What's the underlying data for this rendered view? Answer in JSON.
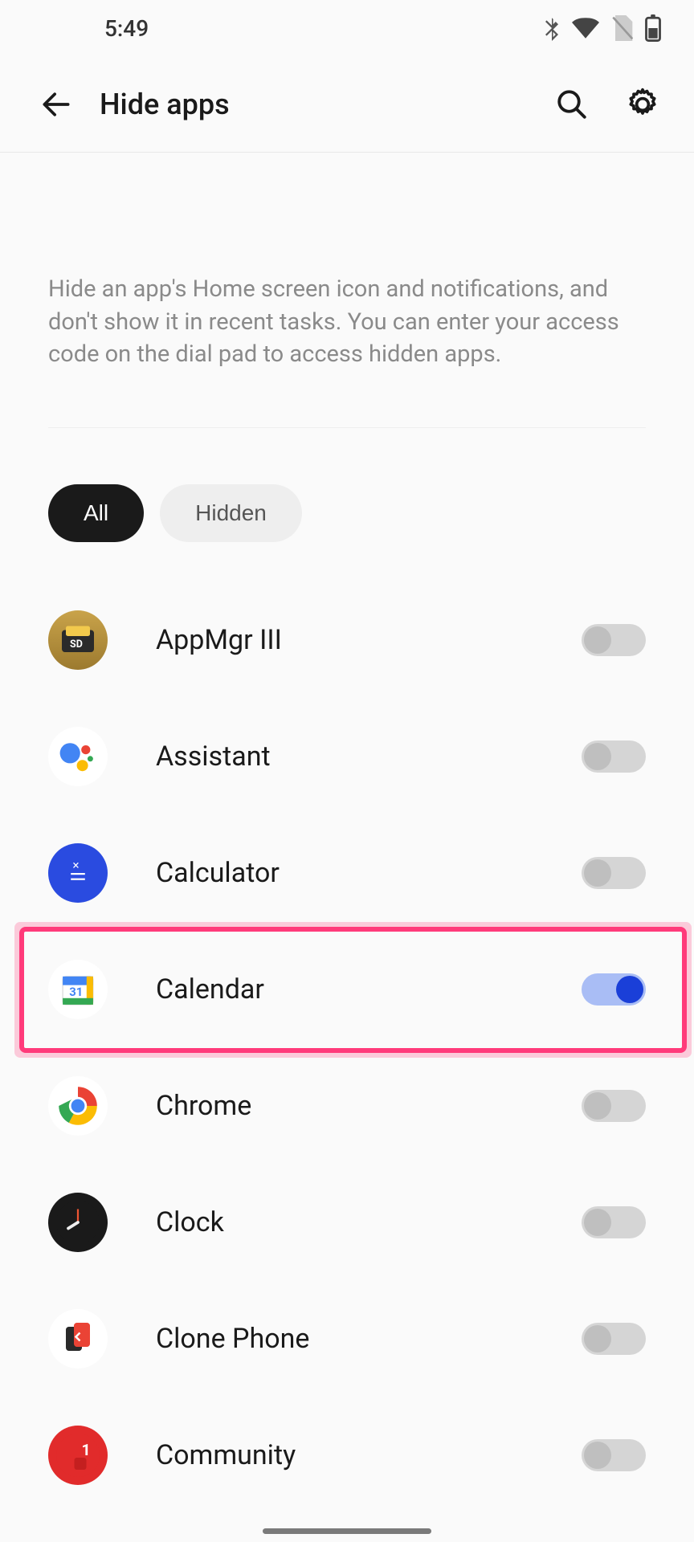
{
  "status": {
    "time": "5:49"
  },
  "header": {
    "title": "Hide apps",
    "description": "Hide an app's Home screen icon and notifications, and don't show it in recent tasks. You can enter your access code on the dial pad to access hidden apps."
  },
  "tabs": {
    "all": "All",
    "hidden": "Hidden",
    "active": "all"
  },
  "apps": [
    {
      "id": "appmgr",
      "name": "AppMgr III",
      "hidden": false,
      "icon_class": "ic-appmgr",
      "highlight": false
    },
    {
      "id": "assistant",
      "name": "Assistant",
      "hidden": false,
      "icon_class": "ic-assistant",
      "highlight": false
    },
    {
      "id": "calculator",
      "name": "Calculator",
      "hidden": false,
      "icon_class": "ic-calculator",
      "highlight": false
    },
    {
      "id": "calendar",
      "name": "Calendar",
      "hidden": true,
      "icon_class": "ic-calendar",
      "highlight": true
    },
    {
      "id": "chrome",
      "name": "Chrome",
      "hidden": false,
      "icon_class": "ic-chrome",
      "highlight": false
    },
    {
      "id": "clock",
      "name": "Clock",
      "hidden": false,
      "icon_class": "ic-clock",
      "highlight": false
    },
    {
      "id": "clone",
      "name": "Clone Phone",
      "hidden": false,
      "icon_class": "ic-clone",
      "highlight": false
    },
    {
      "id": "community",
      "name": "Community",
      "hidden": false,
      "icon_class": "ic-community",
      "highlight": false
    }
  ],
  "colors": {
    "toggle_on_track": "#a9bdf5",
    "toggle_on_knob": "#1a3fd8",
    "highlight_border": "#ff3a7a"
  }
}
